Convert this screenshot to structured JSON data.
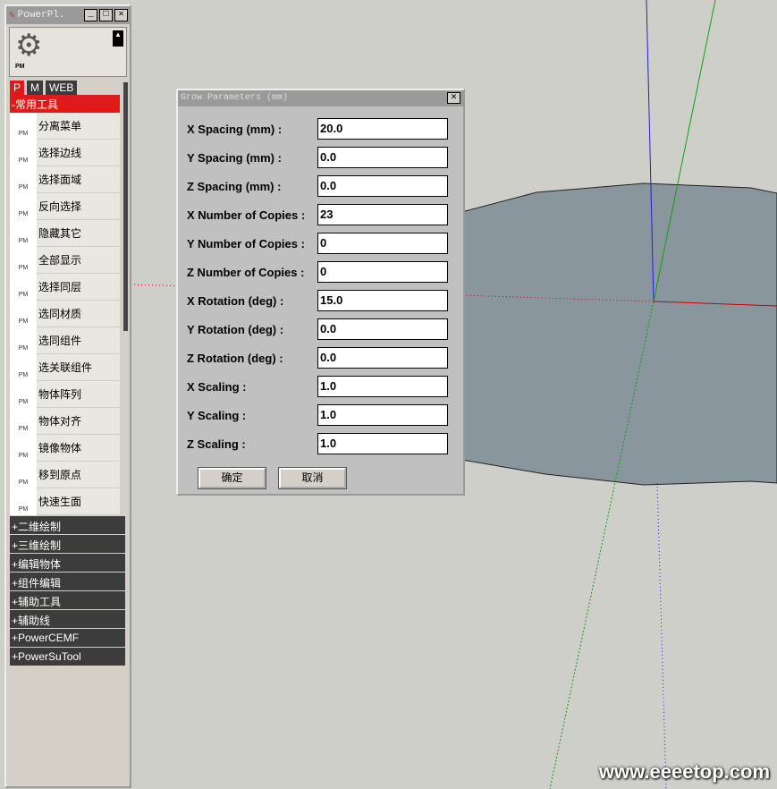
{
  "panel": {
    "title": "PowerPl.",
    "tabs": [
      "P",
      "M",
      "WEB"
    ],
    "section": "-常用工具",
    "items": [
      "分离菜单",
      "选择边线",
      "选择面域",
      "反向选择",
      "隐藏其它",
      "全部显示",
      "选择同层",
      "选同材质",
      "选同组件",
      "选关联组件",
      "物体阵列",
      "物体对齐",
      "镜像物体",
      "移到原点",
      "快速生面"
    ],
    "icon_label": "PM",
    "collapsed": [
      "+二维绘制",
      "+三维绘制",
      "+编辑物体",
      "+组件编辑",
      "+辅助工具",
      "+辅助线",
      "+PowerCEMF",
      "+PowerSuTool"
    ]
  },
  "dialog": {
    "title": "Grow Parameters (mm)",
    "fields": [
      {
        "label": "X Spacing (mm) :",
        "value": "20.0"
      },
      {
        "label": "Y Spacing (mm) :",
        "value": "0.0"
      },
      {
        "label": "Z Spacing (mm) :",
        "value": "0.0"
      },
      {
        "label": "X Number of Copies :",
        "value": "23"
      },
      {
        "label": "Y Number of Copies :",
        "value": "0"
      },
      {
        "label": "Z Number of Copies :",
        "value": "0"
      },
      {
        "label": "X Rotation (deg) :",
        "value": "15.0"
      },
      {
        "label": "Y Rotation (deg) :",
        "value": "0.0"
      },
      {
        "label": "Z Rotation (deg) :",
        "value": "0.0"
      },
      {
        "label": "X Scaling :",
        "value": "1.0"
      },
      {
        "label": "Y Scaling  :",
        "value": "1.0"
      },
      {
        "label": "Z Scaling :",
        "value": "1.0"
      }
    ],
    "ok": "确定",
    "cancel": "取消"
  },
  "watermark": "www.eeeetop.com",
  "colors": {
    "accent": "#e01a1a",
    "dark": "#3c3c3c",
    "face": "#8a969e"
  }
}
